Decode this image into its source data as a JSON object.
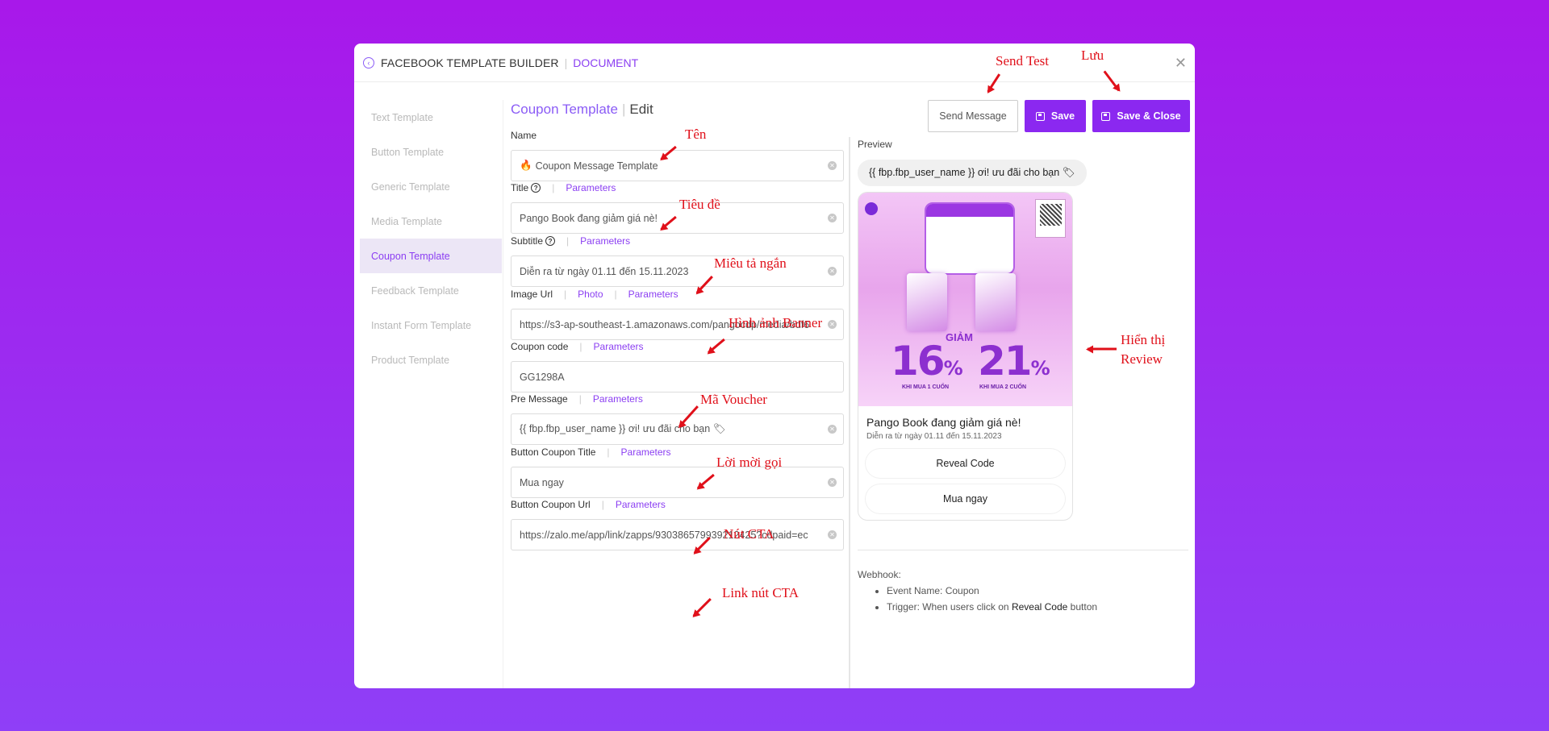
{
  "header": {
    "title": "FACEBOOK TEMPLATE BUILDER",
    "doc": "DOCUMENT"
  },
  "sidebar": {
    "items": [
      {
        "label": "Text Template"
      },
      {
        "label": "Button Template"
      },
      {
        "label": "Generic Template"
      },
      {
        "label": "Media Template"
      },
      {
        "label": "Coupon Template"
      },
      {
        "label": "Feedback Template"
      },
      {
        "label": "Instant Form Template"
      },
      {
        "label": "Product Template"
      }
    ],
    "active_index": 4
  },
  "form": {
    "title": "Coupon Template",
    "mode": "Edit",
    "parameters_label": "Parameters",
    "photo_label": "Photo",
    "fields": {
      "name": {
        "label": "Name",
        "value": "Coupon Message Template"
      },
      "title": {
        "label": "Title",
        "value": "Pango Book đang giảm giá nè!"
      },
      "subtitle": {
        "label": "Subtitle",
        "value": "Diễn ra từ ngày 01.11 đến 15.11.2023"
      },
      "image_url": {
        "label": "Image Url",
        "value": "https://s3-ap-southeast-1.amazonaws.com/pangocdp/media/bdf6"
      },
      "coupon_code": {
        "label": "Coupon code",
        "value": "GG1298A"
      },
      "pre_message": {
        "label": "Pre Message",
        "value": "{{ fbp.fbp_user_name }} ơi! ưu đãi cho bạn 🏷"
      },
      "button_title": {
        "label": "Button Coupon Title",
        "value": "Mua ngay"
      },
      "button_url": {
        "label": "Button Coupon Url",
        "value": "https://zalo.me/app/link/zapps/930386579939212425?cdpaid=ec"
      }
    }
  },
  "toolbar": {
    "send_label": "Send Message",
    "save_label": "Save",
    "save_close_label": "Save & Close"
  },
  "preview": {
    "label": "Preview",
    "pre_message": "{{ fbp.fbp_user_name }} ơi! ưu đãi cho bạn 🏷",
    "card_title": "Pango Book đang giảm giá nè!",
    "card_subtitle": "Diễn ra từ ngày 01.11 đến 15.11.2023",
    "btn_reveal": "Reveal Code",
    "btn_buy": "Mua ngay",
    "banner": {
      "num1": "16",
      "num2": "21",
      "pct": "%",
      "giam": "GIẢM",
      "sub1": "KHI MUA 1 CUỐN",
      "sub2": "KHI MUA 2 CUỐN"
    }
  },
  "webhook": {
    "label": "Webhook:",
    "event": "Event Name: Coupon",
    "trigger_prefix": "Trigger: When users click on",
    "trigger_bold": "Reveal Code",
    "trigger_suffix": "button"
  },
  "annotations": {
    "send_test": "Send Test",
    "luu": "Lưu",
    "ten": "Tên",
    "tieu_de": "Tiêu đề",
    "mieu_ta": "Miêu tả ngắn",
    "hinh_anh": "Hình ảnh Banner",
    "ma_voucher": "Mã Voucher",
    "loi_moi": "Lời mời gọi",
    "nut_cta": "Nút CTA",
    "link_cta": "Link nút CTA",
    "hien_thi_1": "Hiển thị",
    "hien_thi_2": "Review"
  }
}
